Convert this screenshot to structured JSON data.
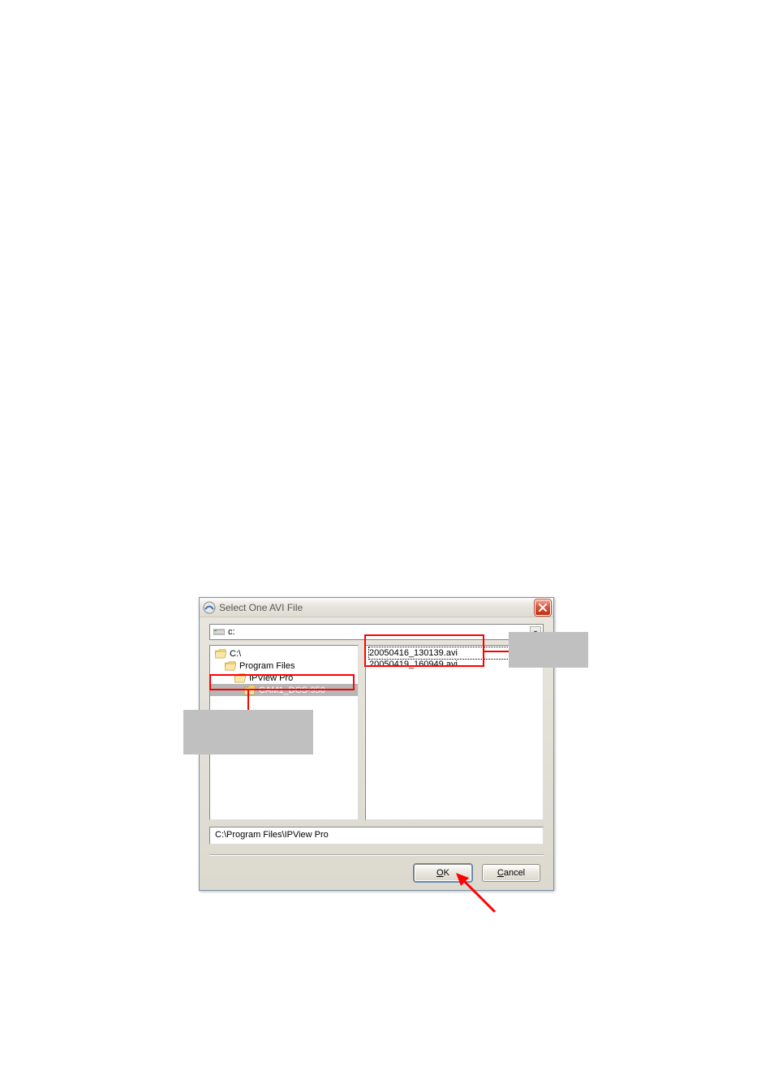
{
  "dialog": {
    "title": "Select One AVI File",
    "drive": "c:",
    "tree": [
      {
        "label": "C:\\",
        "indent": 0,
        "type": "open"
      },
      {
        "label": "Program Files",
        "indent": 1,
        "type": "open"
      },
      {
        "label": "IPView Pro",
        "indent": 2,
        "type": "open"
      },
      {
        "label": "CAM1_DCS-950",
        "indent": 3,
        "type": "open",
        "selected": true
      }
    ],
    "files": [
      {
        "name": "20050416_130139.avi",
        "selected": true
      },
      {
        "name": "20050419_160949.avi",
        "selected": false
      }
    ],
    "path": "C:\\Program Files\\IPView Pro",
    "ok_label": "OK",
    "cancel_label": "Cancel"
  }
}
